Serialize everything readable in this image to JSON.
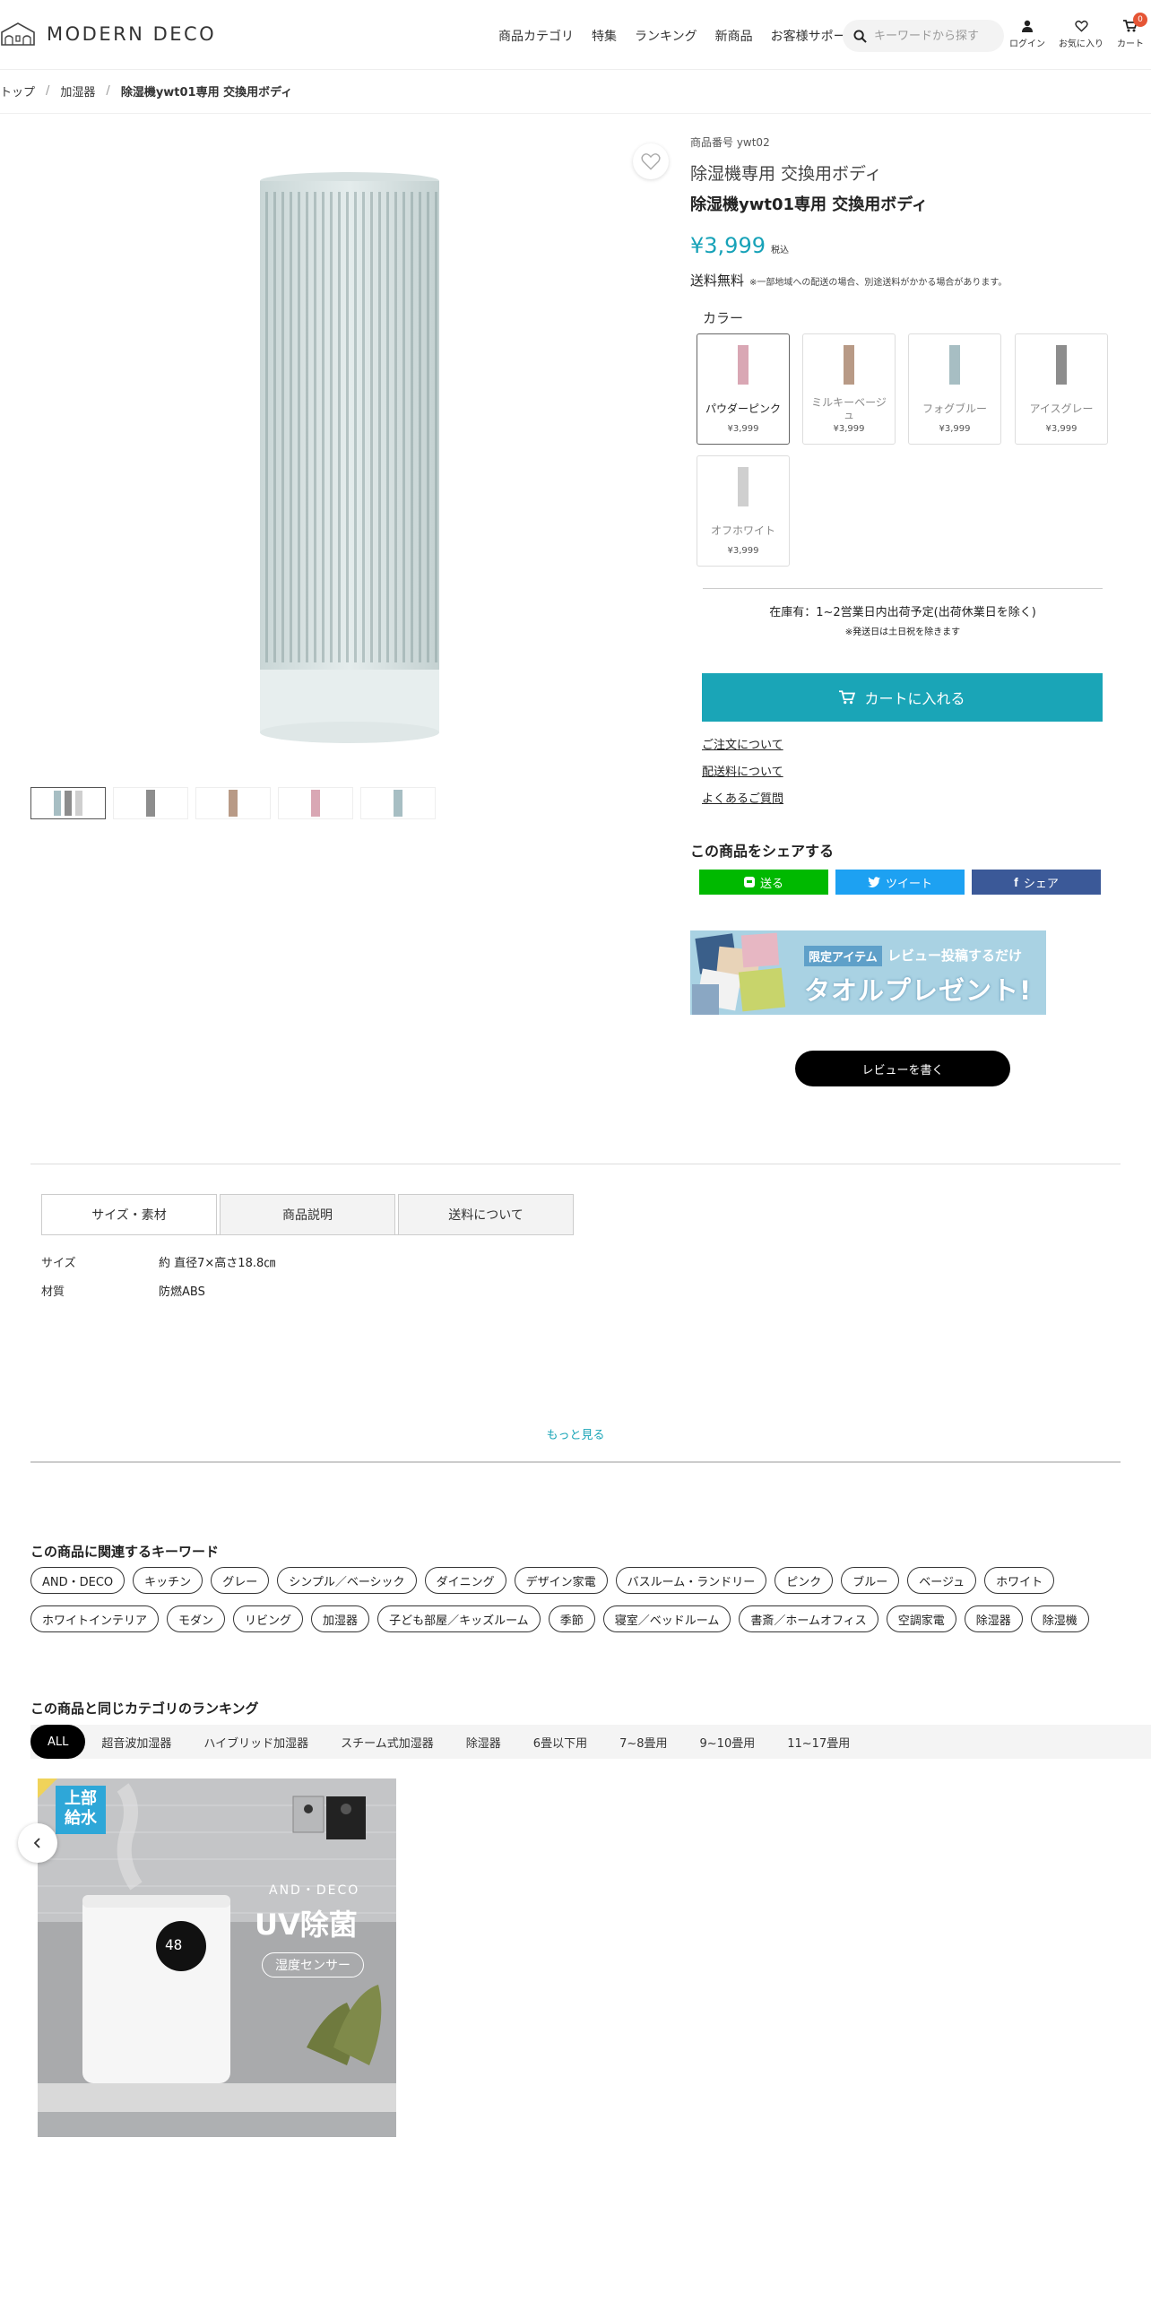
{
  "header": {
    "logo": "MODERN DECO",
    "nav": [
      "商品カテゴリ",
      "特集",
      "ランキング",
      "新商品",
      "お客様サポート"
    ],
    "search_placeholder": "キーワードから探す",
    "login": "ログイン",
    "favorites": "お気に入り",
    "cart": "カート",
    "cart_count": "0"
  },
  "breadcrumb": [
    "トップ",
    "加湿器",
    "除湿機ywt01専用 交換用ボディ"
  ],
  "product": {
    "sku": "商品番号 ywt02",
    "name1": "除湿機専用 交換用ボディ",
    "name2": "除湿機ywt01専用 交換用ボディ",
    "price": "¥3,999",
    "tax": "税込",
    "shipping": "送料無料",
    "shipping_note": "※一部地域への配送の場合、別途送料がかかる場合があります。",
    "color_label": "カラー",
    "colors": [
      {
        "name": "パウダーピンク",
        "price": "¥3,999",
        "color": "#d9a7b4"
      },
      {
        "name": "ミルキーベージュ",
        "price": "¥3,999",
        "color": "#b89a86"
      },
      {
        "name": "フォグブルー",
        "price": "¥3,999",
        "color": "#a7bec3"
      },
      {
        "name": "アイスグレー",
        "price": "¥3,999",
        "color": "#8d8d8d"
      },
      {
        "name": "オフホワイト",
        "price": "¥3,999",
        "color": "#cfcfcf"
      }
    ],
    "stock": "在庫有：1~2営業日内出荷予定(出荷休業日を除く)",
    "stock_note": "※発送日は土日祝を除きます",
    "add_to_cart": "カートに入れる",
    "links": [
      "ご注文について",
      "配送料について",
      "よくあるご質問"
    ]
  },
  "share": {
    "title": "この商品をシェアする",
    "line": "送る",
    "twitter": "ツイート",
    "facebook": "シェア"
  },
  "banner": {
    "tag": "限定アイテム",
    "line1": "レビュー投稿するだけ",
    "line2": "タオルプレゼント!"
  },
  "review_button": "レビューを書く",
  "tabs": [
    "サイズ・素材",
    "商品説明",
    "送料について"
  ],
  "specs": [
    {
      "k": "サイズ",
      "v": "約 直径7×高さ18.8㎝"
    },
    {
      "k": "材質",
      "v": "防燃ABS"
    }
  ],
  "more": "もっと見る",
  "keywords": {
    "title": "この商品に関連するキーワード",
    "row1": [
      "AND・DECO",
      "キッチン",
      "グレー",
      "シンプル／ベーシック",
      "ダイニング",
      "デザイン家電",
      "バスルーム・ランドリー",
      "ピンク",
      "ブルー",
      "ベージュ",
      "ホワイト"
    ],
    "row2": [
      "ホワイトインテリア",
      "モダン",
      "リビング",
      "加湿器",
      "子ども部屋／キッズルーム",
      "季節",
      "寝室／ベッドルーム",
      "書斎／ホームオフィス",
      "空調家電",
      "除湿器",
      "除湿機"
    ]
  },
  "ranking": {
    "title": "この商品と同じカテゴリのランキング",
    "tabs": [
      "ALL",
      "超音波加湿器",
      "ハイブリッド加湿器",
      "スチーム式加湿器",
      "除湿器",
      "6畳以下用",
      "7~8畳用",
      "9~10畳用",
      "11~17畳用"
    ],
    "item": {
      "badge": "上部\n給水",
      "brand": "AND・DECO",
      "headline": "UV除菌",
      "sub": "湿度センサー",
      "display": "48"
    }
  }
}
